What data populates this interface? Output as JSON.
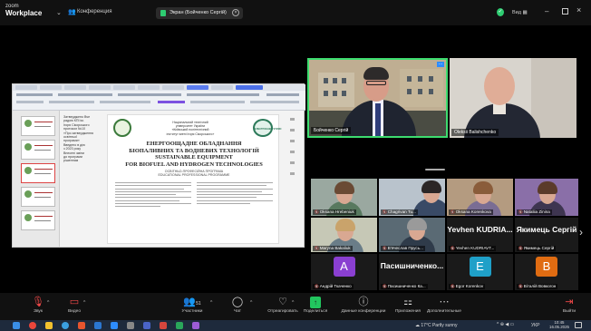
{
  "app": {
    "logo_top": "zoom",
    "logo_bottom": "Workplace",
    "conference_label": "Конференция"
  },
  "share_banner": {
    "label": "Экран (Бойченко Сергій)"
  },
  "title_controls": {
    "view_label": "Вид"
  },
  "shared_screen": {
    "university_header": "Національний технічний\nуніверситет України\n«Київський політехнічний\nінститут імені Ігоря Сікорського»",
    "seal_right_text": "ЕЛЕКТРОЕНЕРГЕТИКИ",
    "doc_title": "ЕНЕРГООЩАДНЕ ОБЛАДНАННЯ\nБІОПАЛИВНИХ ТА ВОДНЕВИХ ТЕХНОЛОГІЙ\nSUSTAINABLE EQUIPMENT\nFOR BIOFUEL AND HYDROGEN TECHNOLOGIES",
    "doc_subtitle": "ОСВІТНЬО-ПРОФЕСІЙНА ПРОГРАМА\nEDUCATIONAL PROFESSIONAL PROGRAMME",
    "side_text": "Затверджено Вче\nрадою КПІ ім.\nІгоря Сікорського\nпротокол №10\n«Про затвердження\nосвітньої\nпрограми»\nВведено в дію\nз 2023 року\nВнесені зміни\nдо програми\nрішенням"
  },
  "participants_top": [
    {
      "name": "Бойченко Сергій",
      "active_speaker": true
    },
    {
      "name": "Oleksii Balishchenko"
    }
  ],
  "gallery": [
    {
      "name": "Oksana Hrebeniuk",
      "muted": true
    },
    {
      "name": "Chagrivan Tu...",
      "muted": true
    },
    {
      "name": "Oksana Korenkova",
      "muted": true
    },
    {
      "name": "Nataliia Zinina",
      "muted": true
    },
    {
      "name": "Maryna Bakaliuk",
      "muted": true
    },
    {
      "name": "В'ячеслав Прусь...",
      "muted": true
    },
    {
      "name": "Yevhen KUDRIAVT...",
      "muted": true,
      "big_label": "Yevhen KUDRIA..."
    },
    {
      "name": "Якимець Сергій",
      "muted": true,
      "big_label": "Якимець Сергій"
    },
    {
      "name": "Андрій Ткаченко",
      "muted": true,
      "avatar": "A",
      "avatar_color": "#8a3fd1"
    },
    {
      "name": "Пасишниченко Ка...",
      "muted": true,
      "big_label": "Пасишниченко..."
    },
    {
      "name": "Egor Korenkov",
      "muted": true,
      "avatar": "E",
      "avatar_color": "#1fa0c8"
    },
    {
      "name": "Віталій Вовкогон",
      "muted": true,
      "avatar": "B",
      "avatar_color": "#e06c12"
    }
  ],
  "toolbar": {
    "audio": "Звук",
    "video": "Видео",
    "participants": "Участники",
    "participants_count": "51",
    "chat": "Чат",
    "react": "Отреагировать",
    "share": "Поделиться",
    "info": "Данные конференции",
    "apps": "Приложения",
    "more": "Дополнительные",
    "leave": "Выйти"
  },
  "taskbar": {
    "weather": "17°C  Partly sunny",
    "lang": "УКР",
    "time": "10:45",
    "date": "16.05.2025"
  }
}
